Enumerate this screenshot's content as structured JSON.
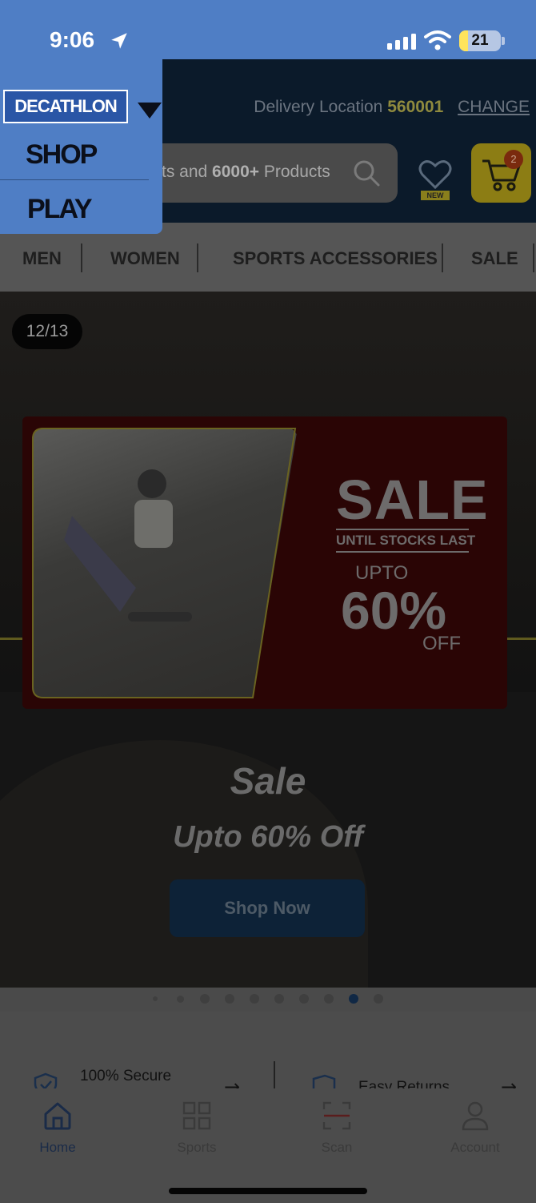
{
  "status_bar": {
    "time": "9:06",
    "battery": "21",
    "battery_level": 0.21
  },
  "brand_menu": {
    "brand": "DECATHLON",
    "options": [
      "SHOP",
      "PLAY"
    ]
  },
  "header": {
    "delivery_label": "Delivery Location",
    "pincode": "560001",
    "change_label": "CHANGE",
    "search_placeholder_prefix": "ts and ",
    "search_placeholder_bold": "6000+",
    "search_placeholder_suffix": " Products",
    "wishlist_tag": "NEW",
    "cart_count": "2"
  },
  "categories": [
    "MEN",
    "WOMEN",
    "SPORTS ACCESSORIES",
    "SALE"
  ],
  "hero": {
    "counter": "12/13",
    "banner": {
      "sale": "SALE",
      "until": "UNTIL STOCKS LAST",
      "upto": "UPTO",
      "percent": "60%",
      "off": "OFF"
    },
    "title": "Sale",
    "subtitle": "Upto 60% Off",
    "cta": "Shop Now"
  },
  "carousel": {
    "total": 10,
    "active_index": 8
  },
  "trust": {
    "secure": "100% Secure",
    "returns": "Easy Returns"
  },
  "tabs": [
    {
      "label": "Home",
      "icon": "home-icon",
      "active": true
    },
    {
      "label": "Sports",
      "icon": "grid-icon",
      "active": false
    },
    {
      "label": "Scan",
      "icon": "scan-icon",
      "active": false
    },
    {
      "label": "Account",
      "icon": "account-icon",
      "active": false
    }
  ]
}
